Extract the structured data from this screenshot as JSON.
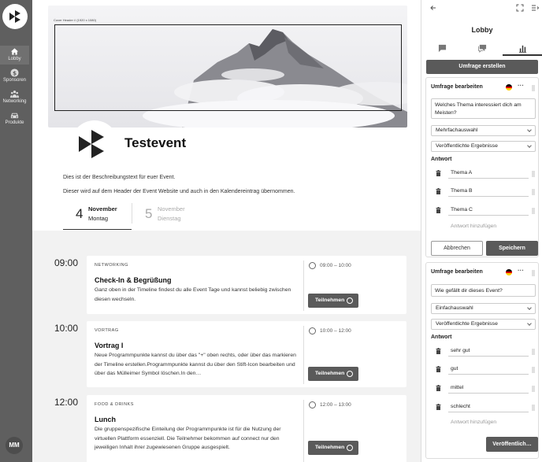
{
  "nav": {
    "items": [
      {
        "label": "Lobby",
        "icon": "home-icon"
      },
      {
        "label": "Sponsoren",
        "icon": "dollar-icon"
      },
      {
        "label": "Networking",
        "icon": "people-icon"
      },
      {
        "label": "Produkte",
        "icon": "car-icon"
      }
    ],
    "avatar_initials": "MM"
  },
  "event": {
    "banner_caption": "Cover Header // (1920 x 1080)",
    "title": "Testevent",
    "description_1": "Dies ist der Beschreibungstext für euer Event.",
    "description_2": "Dieser wird auf dem Header der Event Website und auch in den Kalendereintrag übernommen."
  },
  "days": [
    {
      "num": "4",
      "month": "November",
      "weekday": "Montag",
      "active": true
    },
    {
      "num": "5",
      "month": "November",
      "weekday": "Dienstag",
      "active": false
    }
  ],
  "sessions": [
    {
      "time": "09:00",
      "category": "NETWORKING",
      "title": "Check-In & Begrüßung",
      "text": "Ganz oben in der Timeline findest du alle Event Tage und kannst beliebig zwischen diesen wechseln.",
      "when": "09:00 – 10:00",
      "join": "Teilnehmen"
    },
    {
      "time": "10:00",
      "category": "VORTRAG",
      "title": "Vortrag I",
      "text": "Neue Programmpunkte kannst du über das \"+\" oben rechts, oder über das markieren der Timeline erstellen.Programmpunkte kannst du über den Stift-Icon bearbeiten und über das Mülleimer Symbol löschen.In den…",
      "when": "10:00 – 12:00",
      "join": "Teilnehmen"
    },
    {
      "time": "12:00",
      "category": "FOOD & DRINKS",
      "title": "Lunch",
      "text": "Die gruppenspezifische Einteilung der Programmpunkte ist für die Nutzung der virtuellen Plattform essenziell. Die Teilnehmer bekommen auf connect nur den jeweiligen Inhalt ihrer zugewiesenen Gruppe ausgespielt.",
      "when": "12:00 – 13:00",
      "join": "Teilnehmen"
    }
  ],
  "panel": {
    "title": "Lobby",
    "create_label": "Umfrage erstellen",
    "polls": [
      {
        "heading": "Umfrage bearbeiten",
        "question": "Welches Thema interessiert dich am Meisten?",
        "type": "Mehrfachauswahl",
        "results": "Veröffentlichte Ergebnisse",
        "answers_label": "Antwort",
        "answers": [
          "Thema A",
          "Thema B",
          "Thema C"
        ],
        "add_placeholder": "Antwort hinzufügen",
        "cancel": "Abbrechen",
        "save": "Speichern"
      },
      {
        "heading": "Umfrage bearbeiten",
        "question": "Wie gefällt dir dieses Event?",
        "type": "Einfachauswahl",
        "results": "Veröffentlichte Ergebnisse",
        "answers_label": "Antwort",
        "answers": [
          "sehr gut",
          "gut",
          "mittel",
          "schlecht"
        ],
        "add_placeholder": "Antwort hinzufügen",
        "publish": "Veröffentlich…"
      }
    ]
  },
  "colors": {
    "rail": "#5f5f5f",
    "button_dark": "#5a5a5a",
    "flag_black": "#000000",
    "flag_red": "#dd0000",
    "flag_gold": "#ffce00"
  }
}
